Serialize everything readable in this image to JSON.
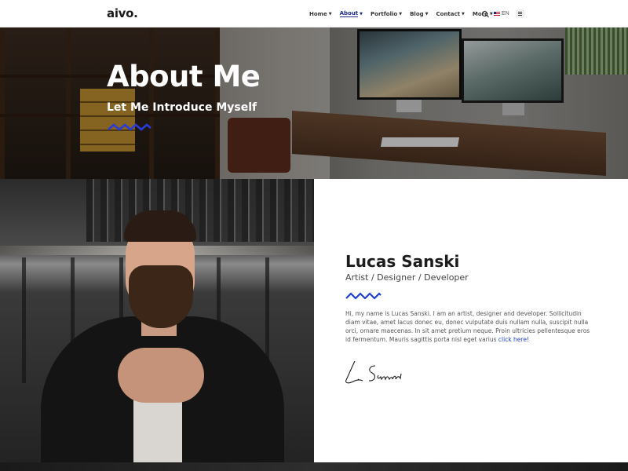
{
  "header": {
    "logo": "aivo.",
    "nav": [
      {
        "label": "Home",
        "active": false
      },
      {
        "label": "About",
        "active": true
      },
      {
        "label": "Portfolio",
        "active": false
      },
      {
        "label": "Blog",
        "active": false
      },
      {
        "label": "Contact",
        "active": false
      },
      {
        "label": "More",
        "active": false
      }
    ],
    "language": "EN",
    "icons": {
      "search": "search-icon",
      "flag": "uk-flag-icon",
      "menu": "menu-icon",
      "dropdown": "chevron-down-icon"
    }
  },
  "hero": {
    "title": "About Me",
    "subtitle": "Let Me Introduce Myself"
  },
  "profile": {
    "name": "Lucas Sanski",
    "role": "Artist / Designer / Developer",
    "bio": "Hi, my name is Lucas Sanski. I am an artist, designer and developer. Sollicitudin diam vitae, amet lacus donec eu, donec vulputate duis nullam nulla, suscipit nulla orci, ornare maecenas. In sit amet pretium neque. Proin ultricies pellentesque eros id fermentum. Mauris sagittis porta nisl eget varius",
    "bio_link": "click here!",
    "signature": "L. Sanski"
  },
  "colors": {
    "accent": "#1e3fd0",
    "nav_active": "#1b2a8a",
    "text_dark": "#1c1c1c",
    "zigzag_hero": "#2a3bd6"
  }
}
